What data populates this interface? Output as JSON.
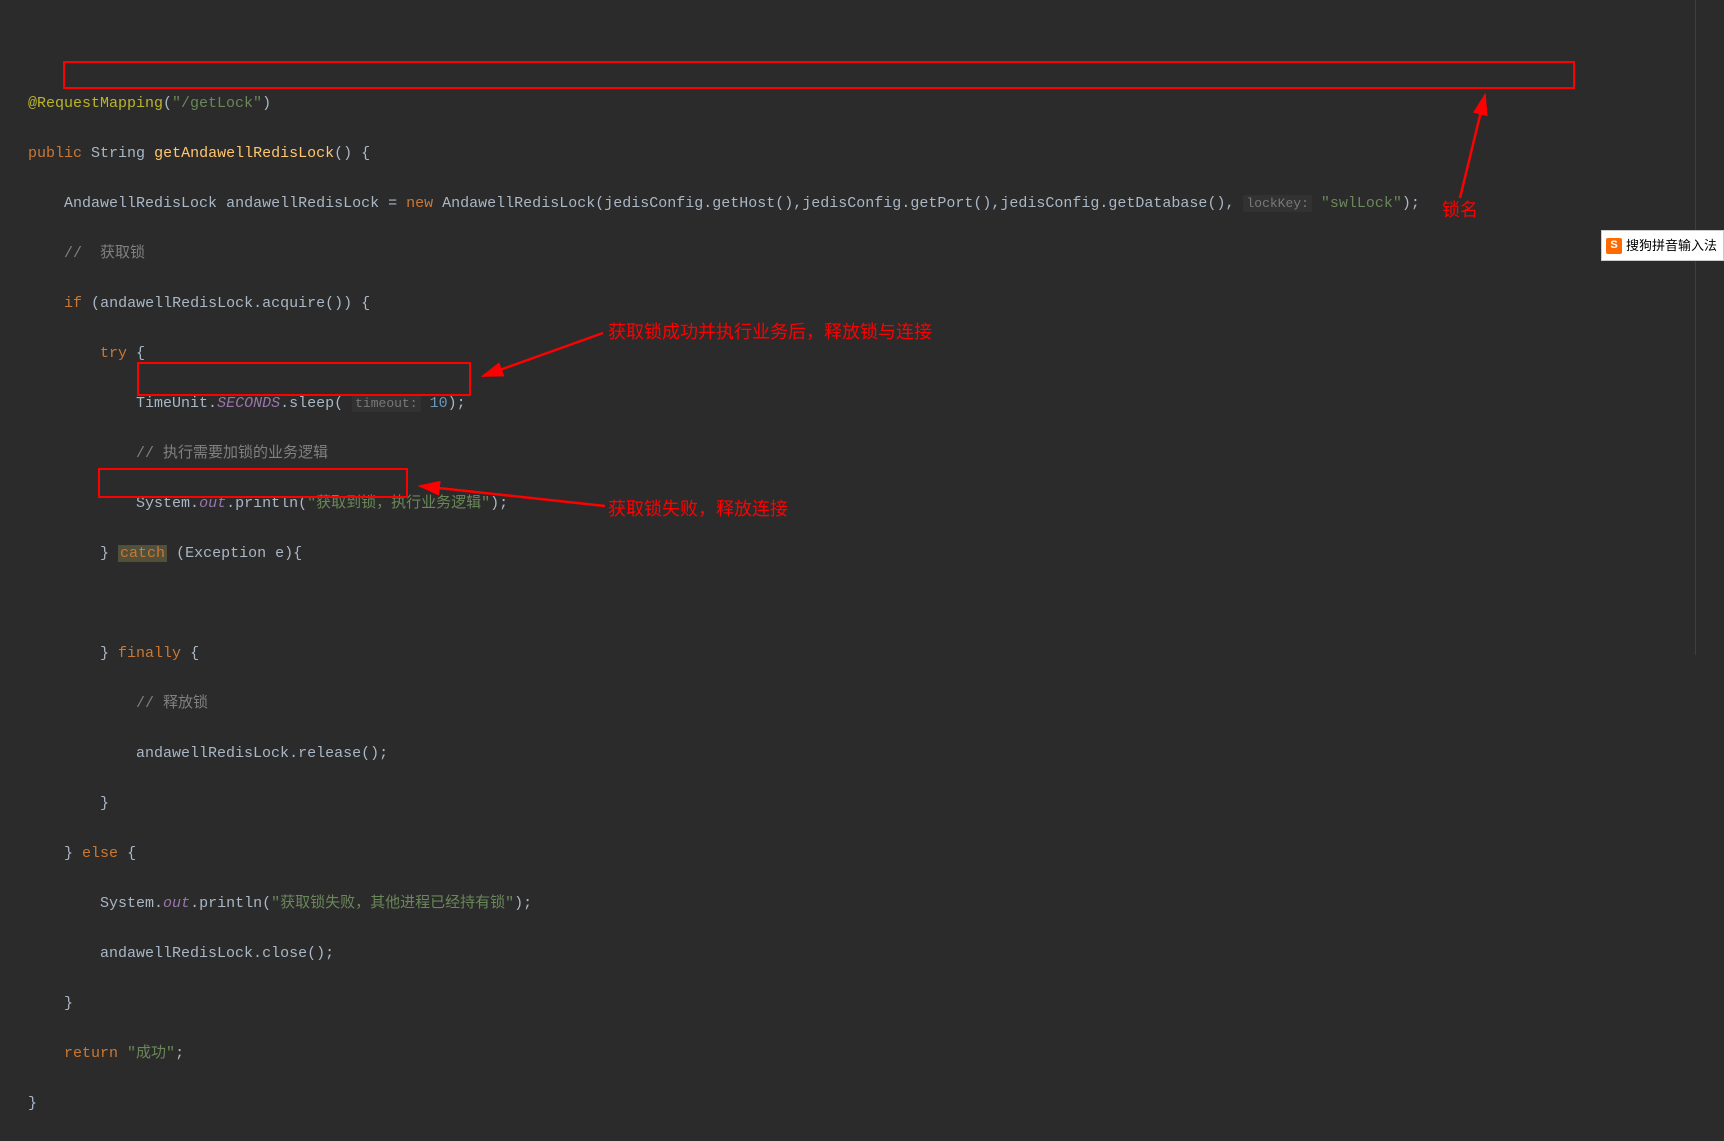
{
  "code": {
    "annotation_name": "@RequestMapping",
    "annotation_path": "\"/getLock\"",
    "kw_public": "public",
    "type_string": "String",
    "method_name": "getAndawellRedisLock",
    "l1_type": "AndawellRedisLock",
    "l1_var": "andawellRedisLock",
    "kw_new": "new",
    "l1_ctor": "AndawellRedisLock",
    "l1_p1_obj": "jedisConfig",
    "l1_p1_m": "getHost",
    "l1_p2_obj": "jedisConfig",
    "l1_p2_m": "getPort",
    "l1_p3_obj": "jedisConfig",
    "l1_p3_m": "getDatabase",
    "l1_hint": "lockKey:",
    "l1_str": "\"swlLock\"",
    "c_getlock": "//  获取锁",
    "kw_if": "if",
    "acquire_var": "andawellRedisLock",
    "acquire_m": "acquire",
    "kw_try": "try",
    "tu_class": "TimeUnit",
    "tu_field": "SECONDS",
    "tu_m": "sleep",
    "tu_hint": "timeout:",
    "tu_num": "10",
    "c_bizlogic": "// 执行需要加锁的业务逻辑",
    "sys1": "System",
    "out1": "out",
    "println1": "println",
    "str_got": "\"获取到锁，执行业务逻辑\"",
    "kw_catch": "catch",
    "exc_type": "Exception",
    "exc_var": "e",
    "kw_finally": "finally",
    "c_release": "// 释放锁",
    "rel_var": "andawellRedisLock",
    "rel_m": "release",
    "kw_else": "else",
    "sys2": "System",
    "out2": "out",
    "println2": "println",
    "str_fail": "\"获取锁失败，其他进程已经持有锁\"",
    "close_var": "andawellRedisLock",
    "close_m": "close",
    "kw_return": "return",
    "str_success": "\"成功\""
  },
  "annotations": {
    "lock_name": "锁名",
    "release_success": "获取锁成功并执行业务后，释放锁与连接",
    "acquire_fail": "获取锁失败，释放连接"
  },
  "ime": {
    "icon_letter": "S",
    "label": "搜狗拼音输入法"
  }
}
